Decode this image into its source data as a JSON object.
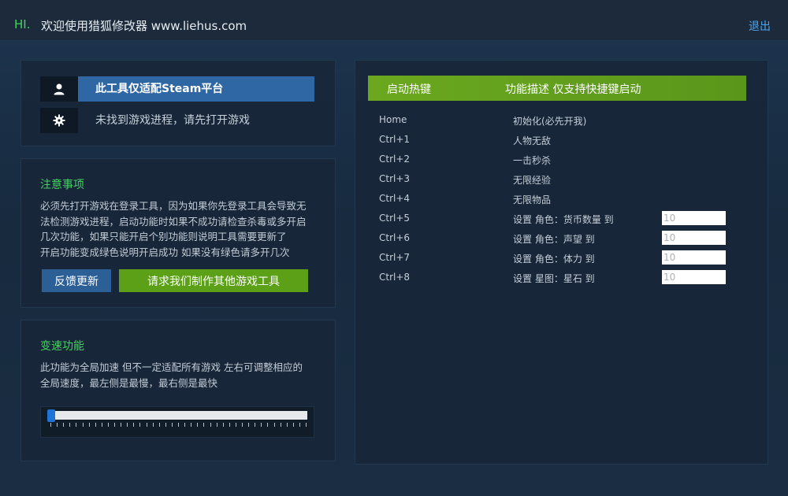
{
  "titlebar": {
    "hi": "HI.",
    "title": "欢迎使用猎狐修改器 www.liehus.com",
    "exit_label": "退出"
  },
  "info": {
    "platform_icon": "user-icon",
    "platform_text": "此工具仅适配Steam平台",
    "status_icon": "gear-icon",
    "status_text": "未找到游戏进程，请先打开游戏"
  },
  "notes": {
    "title": "注意事项",
    "lines": [
      "必须先打开游戏在登录工具，因为如果你先登录工具会导致无",
      "法检测游戏进程，启动功能时如果不成功请检查杀毒或多开启",
      "几次功能，如果只能开启个别功能则说明工具需要更新了",
      "开启功能变成绿色说明开启成功 如果没有绿色请多开几次"
    ],
    "feedback_label": "反馈更新",
    "request_label": "请求我们制作其他游戏工具"
  },
  "speed": {
    "title": "变速功能",
    "lines": [
      "此功能为全局加速 但不一定适配所有游戏 左右可调整相应的",
      "全局速度，最左侧是最慢，最右侧是最快"
    ],
    "slider_value": 0
  },
  "hotkeys": {
    "header_key": "启动热键",
    "header_desc": "功能描述 仅支持快捷键启动",
    "rows": [
      {
        "key": "Home",
        "desc": "初始化(必先开我)"
      },
      {
        "key": "Ctrl+1",
        "desc": "人物无敌"
      },
      {
        "key": "Ctrl+2",
        "desc": "一击秒杀"
      },
      {
        "key": "Ctrl+3",
        "desc": "无限经验"
      },
      {
        "key": "Ctrl+4",
        "desc": "无限物品"
      },
      {
        "key": "Ctrl+5",
        "desc": "设置 角色：货币数量 到",
        "placeholder": "10"
      },
      {
        "key": "Ctrl+6",
        "desc": "设置 角色：声望 到",
        "placeholder": "10"
      },
      {
        "key": "Ctrl+7",
        "desc": "设置 角色：体力 到",
        "placeholder": "10"
      },
      {
        "key": "Ctrl+8",
        "desc": "设置 星图：星石 到",
        "placeholder": "10"
      }
    ]
  },
  "colors": {
    "accent_green": "#43d35f",
    "header_green": "#6ba81f",
    "blue_button": "#2d5f97",
    "link_blue": "#4da6f0"
  }
}
